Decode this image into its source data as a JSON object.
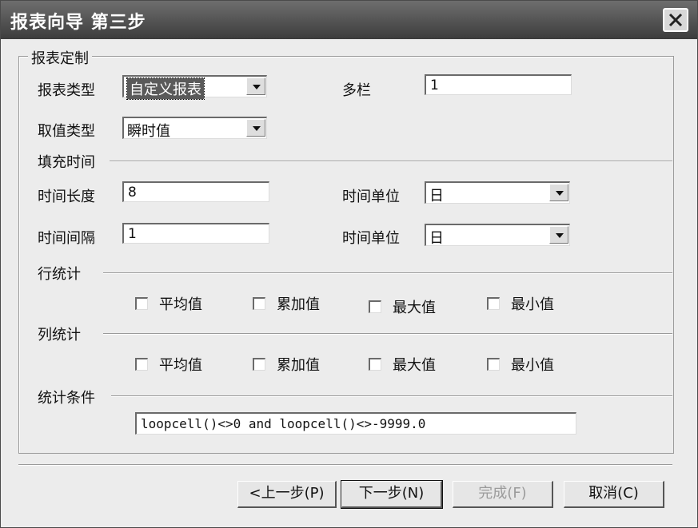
{
  "window": {
    "title": "报表向导 第三步"
  },
  "report": {
    "group_label": "报表定制",
    "report_type_label": "报表类型",
    "report_type_value": "自定义报表",
    "multi_col_label": "多栏",
    "multi_col_value": "1",
    "value_type_label": "取值类型",
    "value_type_value": "瞬时值"
  },
  "fill": {
    "section_label": "填充时间",
    "time_length_label": "时间长度",
    "time_length_value": "8",
    "time_unit_label_1": "时间单位",
    "time_unit_value_1": "日",
    "interval_label": "时间间隔",
    "interval_value": "1",
    "time_unit_label_2": "时间单位",
    "time_unit_value_2": "日"
  },
  "row_stats": {
    "section_label": "行统计",
    "options": [
      {
        "label": "平均值",
        "checked": false
      },
      {
        "label": "累加值",
        "checked": false
      },
      {
        "label": "最大值",
        "checked": false
      },
      {
        "label": "最小值",
        "checked": false
      }
    ]
  },
  "col_stats": {
    "section_label": "列统计",
    "options": [
      {
        "label": "平均值",
        "checked": false
      },
      {
        "label": "累加值",
        "checked": false
      },
      {
        "label": "最大值",
        "checked": false
      },
      {
        "label": "最小值",
        "checked": false
      }
    ]
  },
  "condition": {
    "section_label": "统计条件",
    "value": "loopcell()<>0 and loopcell()<>-9999.0"
  },
  "buttons": {
    "prev": "<上一步(P)",
    "next": "下一步(N)",
    "finish": "完成(F)",
    "cancel": "取消(C)"
  },
  "icons": {
    "close": "close-icon",
    "dropdown": "chevron-down-icon"
  },
  "colors": {
    "titlebar": "#4a4a4a",
    "dialog_bg": "#ececec"
  }
}
